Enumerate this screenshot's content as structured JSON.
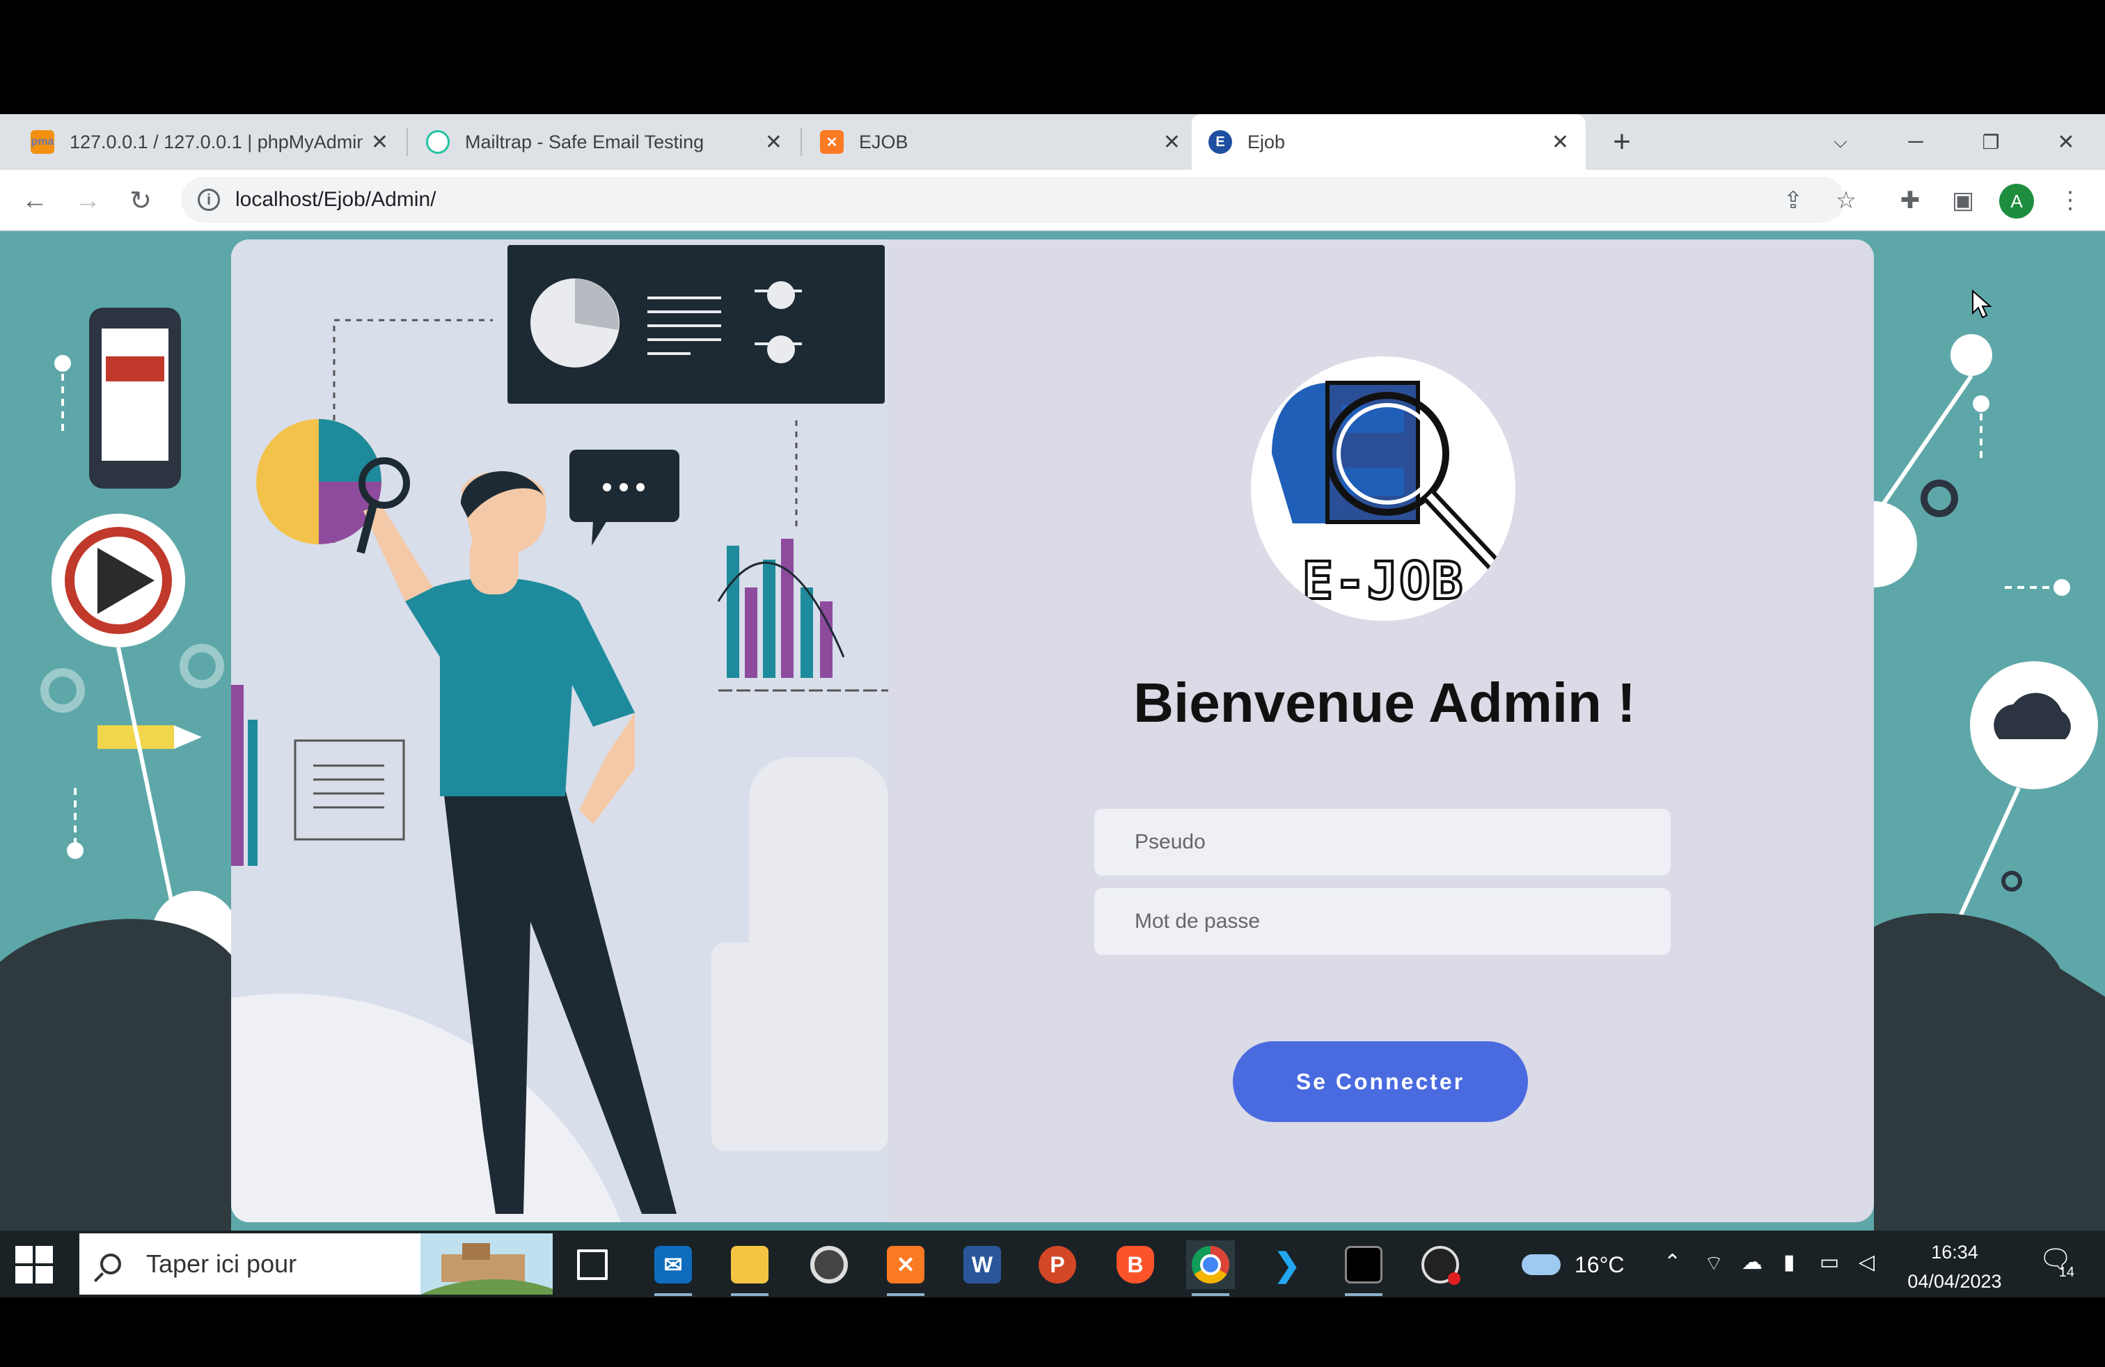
{
  "browser": {
    "tabs": [
      {
        "title": "127.0.0.1 / 127.0.0.1 | phpMyAdmin",
        "icon": "phpmyadmin-icon"
      },
      {
        "title": "Mailtrap - Safe Email Testing",
        "icon": "mailtrap-icon"
      },
      {
        "title": "EJOB",
        "icon": "xampp-icon"
      },
      {
        "title": "Ejob",
        "icon": "ejob-icon",
        "active": true
      }
    ],
    "new_tab": "+",
    "url": "localhost/Ejob/Admin/",
    "profile_initial": "A"
  },
  "login": {
    "logo_text": "E-JOB",
    "welcome": "Bienvenue Admin !",
    "username_placeholder": "Pseudo",
    "password_placeholder": "Mot de passe",
    "submit_label": "Se Connecter"
  },
  "colors": {
    "page_background": "#5ea7a8",
    "card_background": "#dadbe6",
    "button": "#4a6ae0"
  },
  "taskbar": {
    "search_placeholder": "Taper ici pour",
    "weather_temp": "16°C",
    "time": "16:34",
    "date": "04/04/2023",
    "notification_count": "14",
    "apps": [
      "task-view-icon",
      "mail-icon",
      "file-explorer-icon",
      "media-icon",
      "xampp-icon",
      "word-icon",
      "powerpoint-icon",
      "brave-icon",
      "chrome-icon",
      "vscode-icon",
      "terminal-icon",
      "obs-icon"
    ]
  }
}
